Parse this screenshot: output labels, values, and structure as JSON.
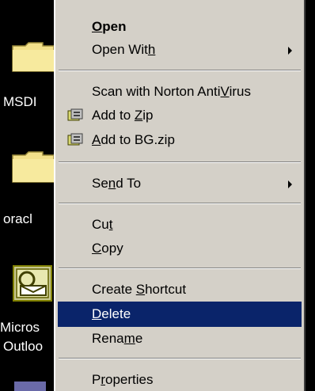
{
  "desktop": {
    "icons": [
      {
        "label": "MSDI"
      },
      {
        "label": "oracl"
      },
      {
        "label_line1": "Micros",
        "label_line2": "Outloo"
      }
    ]
  },
  "context_menu": {
    "items": [
      {
        "pre": "",
        "key": "O",
        "post": "pen"
      },
      {
        "pre": "Open Wit",
        "key": "h",
        "post": ""
      },
      {
        "pre": "Scan with Norton Anti",
        "key": "V",
        "post": "irus"
      },
      {
        "pre": "Add to ",
        "key": "Z",
        "post": "ip"
      },
      {
        "pre": "",
        "key": "A",
        "post": "dd to BG.zip"
      },
      {
        "pre": "Se",
        "key": "n",
        "post": "d To"
      },
      {
        "pre": "Cu",
        "key": "t",
        "post": ""
      },
      {
        "pre": "",
        "key": "C",
        "post": "opy"
      },
      {
        "pre": "Create ",
        "key": "S",
        "post": "hortcut"
      },
      {
        "pre": "",
        "key": "D",
        "post": "elete"
      },
      {
        "pre": "Rena",
        "key": "m",
        "post": "e"
      },
      {
        "pre": "P",
        "key": "r",
        "post": "operties"
      }
    ]
  },
  "colors": {
    "menu_bg": "#d4d0c8",
    "selection": "#0a246a",
    "desktop_bg": "#000000"
  }
}
